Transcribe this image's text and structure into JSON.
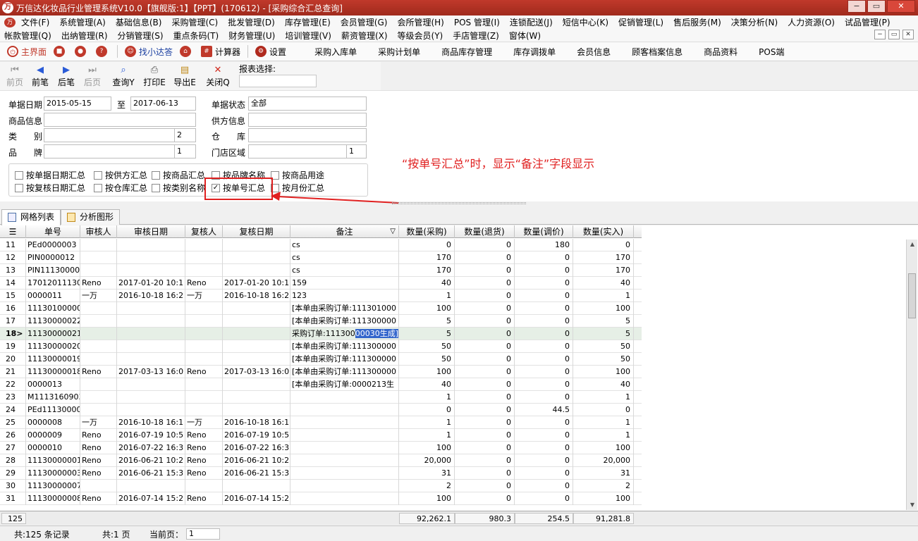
{
  "window": {
    "title": "万信达化妆品行业管理系统V10.0【旗舰版:1】【PPT】(170612) - [采购综合汇总查询]",
    "min_label": "−",
    "restore_label": "▭",
    "close_label": "✕"
  },
  "menu": {
    "row1": [
      "文件(F)",
      "系统管理(A)",
      "基础信息(B)",
      "采购管理(C)",
      "批发管理(D)",
      "库存管理(E)",
      "会员管理(G)",
      "会所管理(H)",
      "POS 管理(I)",
      "连锁配送(J)",
      "短信中心(K)",
      "促销管理(L)",
      "售后服务(M)",
      "决策分析(N)",
      "人力资源(O)",
      "试品管理(P)"
    ],
    "row2": [
      "帐款管理(Q)",
      "出纳管理(R)",
      "分销管理(S)",
      "重点条码(T)",
      "财务管理(U)",
      "培训管理(V)",
      "薪资管理(X)",
      "等级会员(Y)",
      "手店管理(Z)",
      "窗体(W)"
    ]
  },
  "quickbar": {
    "home": "主界面",
    "xiaoda": "找小达答",
    "calculator": "计算器",
    "settings": "设置",
    "links": [
      "采购入库单",
      "采购计划单",
      "商品库存管理",
      "库存调拨单",
      "会员信息",
      "顾客档案信息",
      "商品资料",
      "POS端"
    ]
  },
  "toolbar": {
    "first": "前页",
    "prev": "前笔",
    "next": "后笔",
    "last": "后页",
    "query": "查询",
    "query_key": "Y",
    "print": "打印",
    "print_key": "E",
    "export": "导出",
    "export_key": "E",
    "close": "关闭",
    "close_key": "Q",
    "report_select_label": "报表选择:"
  },
  "filters": {
    "date_label": "单据日期",
    "date_from": "2015-05-15",
    "to_label": "至",
    "date_to": "2017-06-13",
    "status_label": "单据状态",
    "status_value": "全部",
    "product_label": "商品信息",
    "supplier_label": "供方信息",
    "category_label": "类　　别",
    "category_level": "2",
    "warehouse_label": "仓　　库",
    "brand_label": "品　　牌",
    "brand_level": "1",
    "store_label": "门店区域",
    "store_level": "1"
  },
  "checkboxes": [
    {
      "label": "按单据日期汇总",
      "checked": false
    },
    {
      "label": "按供方汇总",
      "checked": false
    },
    {
      "label": "按商品汇总",
      "checked": false
    },
    {
      "label": "按品牌名称",
      "checked": false
    },
    {
      "label": "按商品用途",
      "checked": false
    },
    {
      "label": "按复核日期汇总",
      "checked": false
    },
    {
      "label": "按仓库汇总",
      "checked": false
    },
    {
      "label": "按类别名称",
      "checked": false
    },
    {
      "label": "按单号汇总",
      "checked": true
    },
    {
      "label": "按月份汇总",
      "checked": false
    }
  ],
  "annotation": "“按单号汇总”时，显示“备注”字段显示",
  "tabs": [
    "网格列表",
    "分析图形"
  ],
  "grid": {
    "columns": [
      "",
      "单号",
      "审核人",
      "审核日期",
      "复核人",
      "复核日期",
      "备注",
      "数量(采购)",
      "数量(退货)",
      "数量(调价)",
      "数量(实入)"
    ],
    "sort_indicator": "▽",
    "rows": [
      {
        "n": "11",
        "no": "PEd0000003",
        "auditor": "",
        "audit_date": "",
        "reviewer": "",
        "review_date": "",
        "note": "cs",
        "q1": "0",
        "q2": "0",
        "q3": "180",
        "q4": "0"
      },
      {
        "n": "12",
        "no": "PIN0000012",
        "auditor": "",
        "audit_date": "",
        "reviewer": "",
        "review_date": "",
        "note": "cs",
        "q1": "170",
        "q2": "0",
        "q3": "0",
        "q4": "170"
      },
      {
        "n": "13",
        "no": "PIN111300000",
        "auditor": "",
        "audit_date": "",
        "reviewer": "",
        "review_date": "",
        "note": "cs",
        "q1": "170",
        "q2": "0",
        "q3": "0",
        "q4": "170"
      },
      {
        "n": "14",
        "no": "170120111300",
        "auditor": "Reno",
        "audit_date": "2017-01-20 10:1",
        "reviewer": "Reno",
        "review_date": "2017-01-20 10:1",
        "note": "159",
        "q1": "40",
        "q2": "0",
        "q3": "0",
        "q4": "40"
      },
      {
        "n": "15",
        "no": "0000011",
        "auditor": "一万",
        "audit_date": "2016-10-18 16:2",
        "reviewer": "一万",
        "review_date": "2016-10-18 16:2",
        "note": "123",
        "q1": "1",
        "q2": "0",
        "q3": "0",
        "q4": "1"
      },
      {
        "n": "16",
        "no": "111301000000",
        "auditor": "",
        "audit_date": "",
        "reviewer": "",
        "review_date": "",
        "note": "[本单由采购订单:111301000",
        "q1": "100",
        "q2": "0",
        "q3": "0",
        "q4": "100"
      },
      {
        "n": "17",
        "no": "11130000022",
        "auditor": "",
        "audit_date": "",
        "reviewer": "",
        "review_date": "",
        "note": "[本单由采购订单:111300000",
        "q1": "5",
        "q2": "0",
        "q3": "0",
        "q4": "5"
      },
      {
        "n": "18",
        "no": "11130000021",
        "auditor": "",
        "audit_date": "",
        "reviewer": "",
        "review_date": "",
        "note": "采购订单:111300",
        "note_hl": "00030生成]",
        "q1": "5",
        "q2": "0",
        "q3": "0",
        "q4": "5",
        "selected": true
      },
      {
        "n": "19",
        "no": "11130000020",
        "auditor": "",
        "audit_date": "",
        "reviewer": "",
        "review_date": "",
        "note": "[本单由采购订单:111300000",
        "q1": "50",
        "q2": "0",
        "q3": "0",
        "q4": "50"
      },
      {
        "n": "20",
        "no": "11130000019",
        "auditor": "",
        "audit_date": "",
        "reviewer": "",
        "review_date": "",
        "note": "[本单由采购订单:111300000",
        "q1": "50",
        "q2": "0",
        "q3": "0",
        "q4": "50"
      },
      {
        "n": "21",
        "no": "11130000018",
        "auditor": "Reno",
        "audit_date": "2017-03-13 16:0",
        "reviewer": "Reno",
        "review_date": "2017-03-13 16:0",
        "note": "[本单由采购订单:111300000",
        "q1": "100",
        "q2": "0",
        "q3": "0",
        "q4": "100"
      },
      {
        "n": "22",
        "no": "0000013",
        "auditor": "",
        "audit_date": "",
        "reviewer": "",
        "review_date": "",
        "note": "[本单由采购订单:0000213生",
        "q1": "40",
        "q2": "0",
        "q3": "0",
        "q4": "40"
      },
      {
        "n": "23",
        "no": "M11131609031",
        "auditor": "",
        "audit_date": "",
        "reviewer": "",
        "review_date": "",
        "note": "",
        "q1": "1",
        "q2": "0",
        "q3": "0",
        "q4": "1"
      },
      {
        "n": "24",
        "no": "PEd111300000",
        "auditor": "",
        "audit_date": "",
        "reviewer": "",
        "review_date": "",
        "note": "",
        "q1": "0",
        "q2": "0",
        "q3": "44.5",
        "q4": "0"
      },
      {
        "n": "25",
        "no": "0000008",
        "auditor": "一万",
        "audit_date": "2016-10-18 16:1",
        "reviewer": "一万",
        "review_date": "2016-10-18 16:1",
        "note": "",
        "q1": "1",
        "q2": "0",
        "q3": "0",
        "q4": "1"
      },
      {
        "n": "26",
        "no": "0000009",
        "auditor": "Reno",
        "audit_date": "2016-07-19 10:5",
        "reviewer": "Reno",
        "review_date": "2016-07-19 10:5",
        "note": "",
        "q1": "1",
        "q2": "0",
        "q3": "0",
        "q4": "1"
      },
      {
        "n": "27",
        "no": "0000010",
        "auditor": "Reno",
        "audit_date": "2016-07-22 16:3",
        "reviewer": "Reno",
        "review_date": "2016-07-22 16:3",
        "note": "",
        "q1": "100",
        "q2": "0",
        "q3": "0",
        "q4": "100"
      },
      {
        "n": "28",
        "no": "11130000001",
        "auditor": "Reno",
        "audit_date": "2016-06-21 10:2",
        "reviewer": "Reno",
        "review_date": "2016-06-21 10:2",
        "note": "",
        "q1": "20,000",
        "q2": "0",
        "q3": "0",
        "q4": "20,000"
      },
      {
        "n": "29",
        "no": "11130000003",
        "auditor": "Reno",
        "audit_date": "2016-06-21 15:3",
        "reviewer": "Reno",
        "review_date": "2016-06-21 15:3",
        "note": "",
        "q1": "31",
        "q2": "0",
        "q3": "0",
        "q4": "31"
      },
      {
        "n": "30",
        "no": "11130000007",
        "auditor": "",
        "audit_date": "",
        "reviewer": "",
        "review_date": "",
        "note": "",
        "q1": "2",
        "q2": "0",
        "q3": "0",
        "q4": "2"
      },
      {
        "n": "31",
        "no": "11130000008",
        "auditor": "Reno",
        "audit_date": "2016-07-14 15:2",
        "reviewer": "Reno",
        "review_date": "2016-07-14 15:2",
        "note": "",
        "q1": "100",
        "q2": "0",
        "q3": "0",
        "q4": "100"
      }
    ],
    "footer": {
      "count": "125",
      "q1": "92,262.1",
      "q2": "980.3",
      "q3": "254.5",
      "q4": "91,281.8"
    }
  },
  "status": {
    "records": "共:125 条记录",
    "pages": "共:1 页",
    "current_label": "当前页：",
    "current_value": "1"
  },
  "colors": {
    "brand": "#c0392b",
    "annotation": "#e02020",
    "selected_row": "#e6efe6",
    "highlight": "#3366cc"
  }
}
